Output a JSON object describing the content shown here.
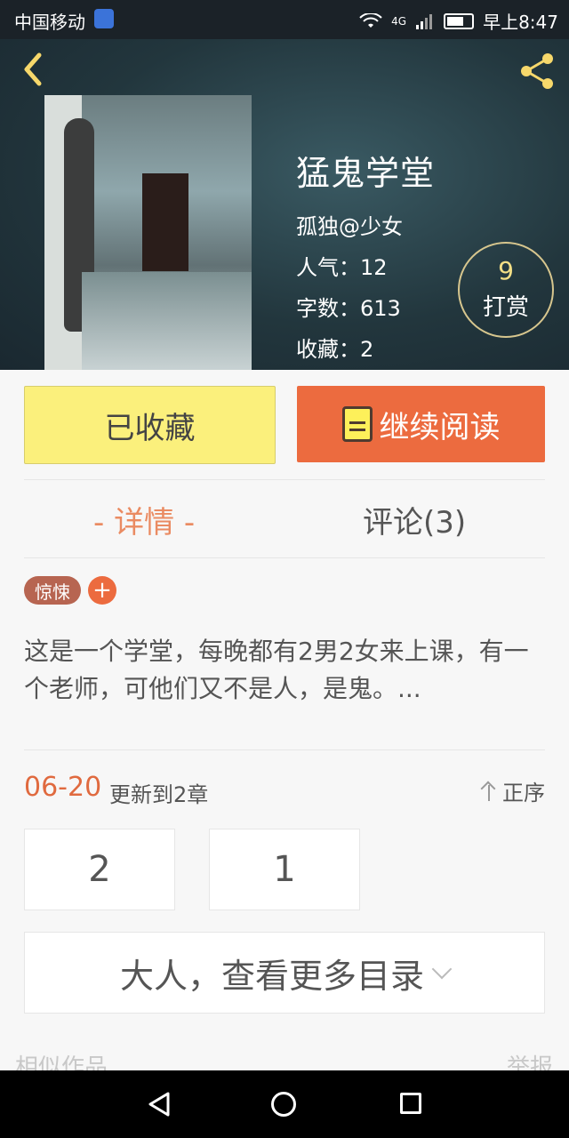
{
  "status_bar": {
    "carrier": "中国移动",
    "network": "4G",
    "time": "早上8:47"
  },
  "book": {
    "title": "猛鬼学堂",
    "author": "孤独@少女",
    "popularity_label": "人气：",
    "popularity": "12",
    "words_label": "字数：",
    "words": "613",
    "favorites_label": "收藏：",
    "favorites": "2"
  },
  "reward": {
    "count": "9",
    "label": "打赏"
  },
  "actions": {
    "collected_label": "已收藏",
    "read_label": "继续阅读"
  },
  "tabs": {
    "detail": "- 详情 -",
    "comments": "评论(3)"
  },
  "tags": {
    "genre": "惊悚",
    "add": "+"
  },
  "description": "这是一个学堂，每晚都有2男2女来上课，有一个老师，可他们又不是人，是鬼。...",
  "update": {
    "date": "06-20",
    "text": "更新到2章",
    "sort_label": "正序"
  },
  "chapters": [
    "2",
    "1"
  ],
  "more_catalog": "大人，查看更多目录",
  "bottom": {
    "similar": "相似作品",
    "report": "举报"
  },
  "colors": {
    "accent_orange": "#ec6b3f",
    "collected_yellow": "#fbf07c",
    "tab_active": "#ea8b62"
  },
  "icons": {
    "back": "back-arrow-icon",
    "share": "share-icon",
    "book": "book-icon",
    "sort": "sort-up-icon",
    "chevron": "chevron-down-icon"
  }
}
